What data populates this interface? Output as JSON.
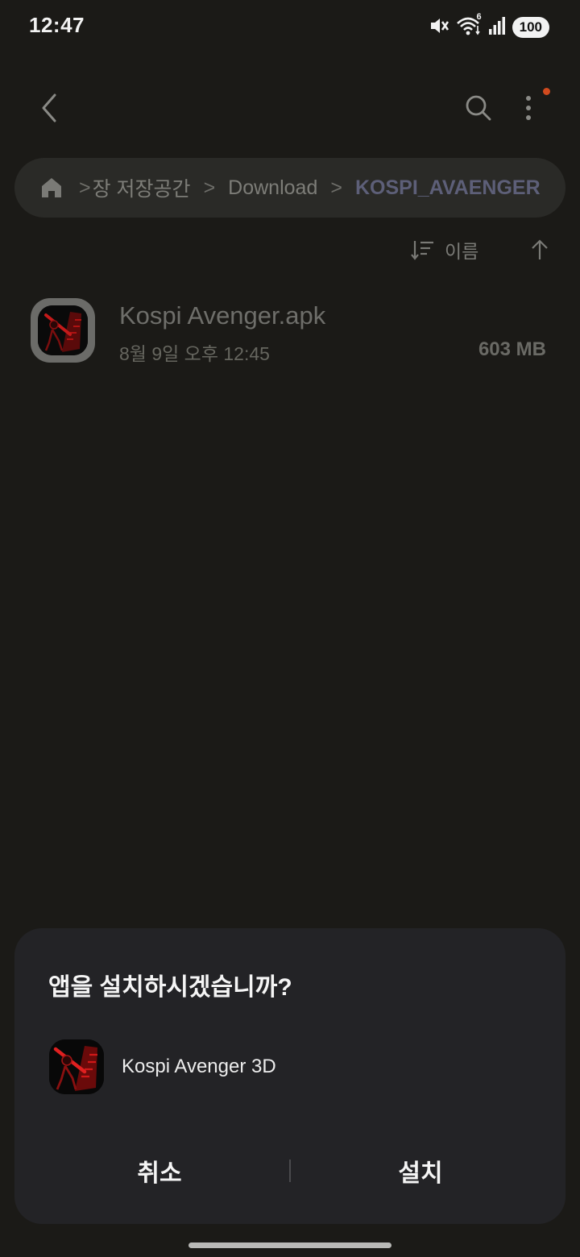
{
  "status_bar": {
    "time": "12:47",
    "battery": "100",
    "wifi_badge": "6",
    "icons": [
      "mute-icon",
      "wifi-icon",
      "signal-icon",
      "battery-icon"
    ]
  },
  "toolbar": {
    "icons": [
      "back-arrow-icon",
      "search-icon",
      "more-vert-icon"
    ],
    "notification_dot_color": "#d14a1e"
  },
  "breadcrumb": {
    "home_icon": "home-icon",
    "items": [
      "장 저장공간",
      "Download"
    ],
    "current": "KOSPI_AVAENGER"
  },
  "sort": {
    "label": "이름",
    "icons": [
      "sort-icon",
      "arrow-up-icon"
    ]
  },
  "files": [
    {
      "name": "Kospi Avenger.apk",
      "date": "8월 9일 오후 12:45",
      "size": "603 MB"
    }
  ],
  "dialog": {
    "title": "앱을 설치하시겠습니까?",
    "app_name": "Kospi Avenger 3D",
    "cancel": "취소",
    "install": "설치"
  }
}
